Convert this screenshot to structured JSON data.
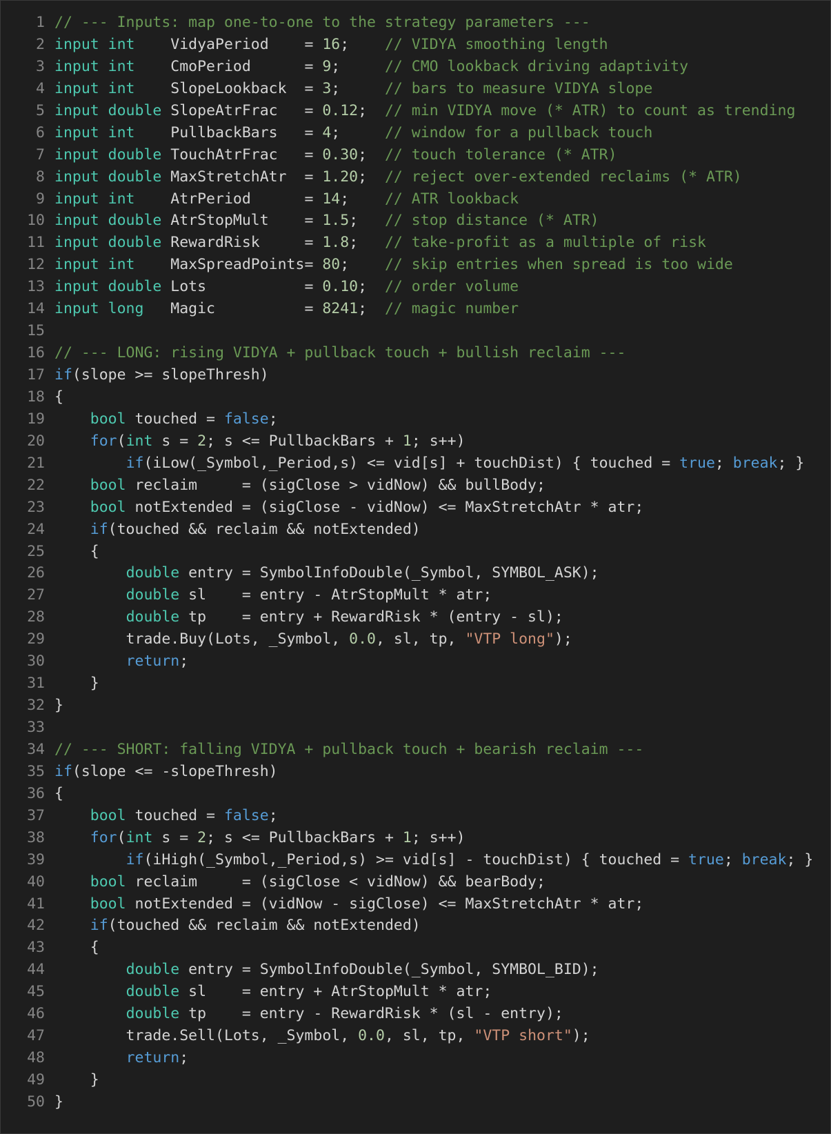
{
  "editor": {
    "colors": {
      "background": "#1e1e1e",
      "line_number": "#858585",
      "plain": "#d4d4d4",
      "keyword": "#569cd6",
      "type": "#4ec9b0",
      "number": "#b5cea8",
      "string": "#ce9178",
      "comment": "#6a9955"
    },
    "lines": [
      {
        "n": "1",
        "tokens": [
          [
            "com",
            "// --- Inputs: map one-to-one to the strategy parameters ---"
          ]
        ]
      },
      {
        "n": "2",
        "tokens": [
          [
            "type",
            "input int"
          ],
          [
            "plain",
            "    VidyaPeriod    = "
          ],
          [
            "num",
            "16"
          ],
          [
            "plain",
            ";    "
          ],
          [
            "com",
            "// VIDYA smoothing length"
          ]
        ]
      },
      {
        "n": "3",
        "tokens": [
          [
            "type",
            "input int"
          ],
          [
            "plain",
            "    CmoPeriod      = "
          ],
          [
            "num",
            "9"
          ],
          [
            "plain",
            ";     "
          ],
          [
            "com",
            "// CMO lookback driving adaptivity"
          ]
        ]
      },
      {
        "n": "4",
        "tokens": [
          [
            "type",
            "input int"
          ],
          [
            "plain",
            "    SlopeLookback  = "
          ],
          [
            "num",
            "3"
          ],
          [
            "plain",
            ";     "
          ],
          [
            "com",
            "// bars to measure VIDYA slope"
          ]
        ]
      },
      {
        "n": "5",
        "tokens": [
          [
            "type",
            "input double"
          ],
          [
            "plain",
            " SlopeAtrFrac   = "
          ],
          [
            "num",
            "0.12"
          ],
          [
            "plain",
            ";  "
          ],
          [
            "com",
            "// min VIDYA move (* ATR) to count as trending"
          ]
        ]
      },
      {
        "n": "6",
        "tokens": [
          [
            "type",
            "input int"
          ],
          [
            "plain",
            "    PullbackBars   = "
          ],
          [
            "num",
            "4"
          ],
          [
            "plain",
            ";     "
          ],
          [
            "com",
            "// window for a pullback touch"
          ]
        ]
      },
      {
        "n": "7",
        "tokens": [
          [
            "type",
            "input double"
          ],
          [
            "plain",
            " TouchAtrFrac   = "
          ],
          [
            "num",
            "0.30"
          ],
          [
            "plain",
            ";  "
          ],
          [
            "com",
            "// touch tolerance (* ATR)"
          ]
        ]
      },
      {
        "n": "8",
        "tokens": [
          [
            "type",
            "input double"
          ],
          [
            "plain",
            " MaxStretchAtr  = "
          ],
          [
            "num",
            "1.20"
          ],
          [
            "plain",
            ";  "
          ],
          [
            "com",
            "// reject over-extended reclaims (* ATR)"
          ]
        ]
      },
      {
        "n": "9",
        "tokens": [
          [
            "type",
            "input int"
          ],
          [
            "plain",
            "    AtrPeriod      = "
          ],
          [
            "num",
            "14"
          ],
          [
            "plain",
            ";    "
          ],
          [
            "com",
            "// ATR lookback"
          ]
        ]
      },
      {
        "n": "10",
        "tokens": [
          [
            "type",
            "input double"
          ],
          [
            "plain",
            " AtrStopMult    = "
          ],
          [
            "num",
            "1.5"
          ],
          [
            "plain",
            ";   "
          ],
          [
            "com",
            "// stop distance (* ATR)"
          ]
        ]
      },
      {
        "n": "11",
        "tokens": [
          [
            "type",
            "input double"
          ],
          [
            "plain",
            " RewardRisk     = "
          ],
          [
            "num",
            "1.8"
          ],
          [
            "plain",
            ";   "
          ],
          [
            "com",
            "// take-profit as a multiple of risk"
          ]
        ]
      },
      {
        "n": "12",
        "tokens": [
          [
            "type",
            "input int"
          ],
          [
            "plain",
            "    MaxSpreadPoints= "
          ],
          [
            "num",
            "80"
          ],
          [
            "plain",
            ";    "
          ],
          [
            "com",
            "// skip entries when spread is too wide"
          ]
        ]
      },
      {
        "n": "13",
        "tokens": [
          [
            "type",
            "input double"
          ],
          [
            "plain",
            " Lots           = "
          ],
          [
            "num",
            "0.10"
          ],
          [
            "plain",
            ";  "
          ],
          [
            "com",
            "// order volume"
          ]
        ]
      },
      {
        "n": "14",
        "tokens": [
          [
            "type",
            "input long"
          ],
          [
            "plain",
            "   Magic          = "
          ],
          [
            "num",
            "8241"
          ],
          [
            "plain",
            ";  "
          ],
          [
            "com",
            "// magic number"
          ]
        ]
      },
      {
        "n": "15",
        "tokens": []
      },
      {
        "n": "16",
        "tokens": [
          [
            "com",
            "// --- LONG: rising VIDYA + pullback touch + bullish reclaim ---"
          ]
        ]
      },
      {
        "n": "17",
        "tokens": [
          [
            "kw",
            "if"
          ],
          [
            "plain",
            "(slope >= slopeThresh)"
          ]
        ]
      },
      {
        "n": "18",
        "tokens": [
          [
            "plain",
            "{"
          ]
        ]
      },
      {
        "n": "19",
        "tokens": [
          [
            "plain",
            "    "
          ],
          [
            "type",
            "bool"
          ],
          [
            "plain",
            " touched = "
          ],
          [
            "kw",
            "false"
          ],
          [
            "plain",
            ";"
          ]
        ]
      },
      {
        "n": "20",
        "tokens": [
          [
            "plain",
            "    "
          ],
          [
            "kw",
            "for"
          ],
          [
            "plain",
            "("
          ],
          [
            "type",
            "int"
          ],
          [
            "plain",
            " s = "
          ],
          [
            "num",
            "2"
          ],
          [
            "plain",
            "; s <= PullbackBars + "
          ],
          [
            "num",
            "1"
          ],
          [
            "plain",
            "; s++)"
          ]
        ]
      },
      {
        "n": "21",
        "tokens": [
          [
            "plain",
            "        "
          ],
          [
            "kw",
            "if"
          ],
          [
            "plain",
            "(iLow(_Symbol,_Period,s) <= vid[s] + touchDist) { touched = "
          ],
          [
            "kw",
            "true"
          ],
          [
            "plain",
            "; "
          ],
          [
            "kw",
            "break"
          ],
          [
            "plain",
            "; }"
          ]
        ]
      },
      {
        "n": "22",
        "tokens": [
          [
            "plain",
            "    "
          ],
          [
            "type",
            "bool"
          ],
          [
            "plain",
            " reclaim     = (sigClose > vidNow) && bullBody;"
          ]
        ]
      },
      {
        "n": "23",
        "tokens": [
          [
            "plain",
            "    "
          ],
          [
            "type",
            "bool"
          ],
          [
            "plain",
            " notExtended = (sigClose - vidNow) <= MaxStretchAtr * atr;"
          ]
        ]
      },
      {
        "n": "24",
        "tokens": [
          [
            "plain",
            "    "
          ],
          [
            "kw",
            "if"
          ],
          [
            "plain",
            "(touched && reclaim && notExtended)"
          ]
        ]
      },
      {
        "n": "25",
        "tokens": [
          [
            "plain",
            "    {"
          ]
        ]
      },
      {
        "n": "26",
        "tokens": [
          [
            "plain",
            "        "
          ],
          [
            "type",
            "double"
          ],
          [
            "plain",
            " entry = SymbolInfoDouble(_Symbol, SYMBOL_ASK);"
          ]
        ]
      },
      {
        "n": "27",
        "tokens": [
          [
            "plain",
            "        "
          ],
          [
            "type",
            "double"
          ],
          [
            "plain",
            " sl    = entry - AtrStopMult * atr;"
          ]
        ]
      },
      {
        "n": "28",
        "tokens": [
          [
            "plain",
            "        "
          ],
          [
            "type",
            "double"
          ],
          [
            "plain",
            " tp    = entry + RewardRisk * (entry - sl);"
          ]
        ]
      },
      {
        "n": "29",
        "tokens": [
          [
            "plain",
            "        trade.Buy(Lots, _Symbol, "
          ],
          [
            "num",
            "0.0"
          ],
          [
            "plain",
            ", sl, tp, "
          ],
          [
            "str",
            "\"VTP long\""
          ],
          [
            "plain",
            ");"
          ]
        ]
      },
      {
        "n": "30",
        "tokens": [
          [
            "plain",
            "        "
          ],
          [
            "kw",
            "return"
          ],
          [
            "plain",
            ";"
          ]
        ]
      },
      {
        "n": "31",
        "tokens": [
          [
            "plain",
            "    }"
          ]
        ]
      },
      {
        "n": "32",
        "tokens": [
          [
            "plain",
            "}"
          ]
        ]
      },
      {
        "n": "33",
        "tokens": []
      },
      {
        "n": "34",
        "tokens": [
          [
            "com",
            "// --- SHORT: falling VIDYA + pullback touch + bearish reclaim ---"
          ]
        ]
      },
      {
        "n": "35",
        "tokens": [
          [
            "kw",
            "if"
          ],
          [
            "plain",
            "(slope <= -slopeThresh)"
          ]
        ]
      },
      {
        "n": "36",
        "tokens": [
          [
            "plain",
            "{"
          ]
        ]
      },
      {
        "n": "37",
        "tokens": [
          [
            "plain",
            "    "
          ],
          [
            "type",
            "bool"
          ],
          [
            "plain",
            " touched = "
          ],
          [
            "kw",
            "false"
          ],
          [
            "plain",
            ";"
          ]
        ]
      },
      {
        "n": "38",
        "tokens": [
          [
            "plain",
            "    "
          ],
          [
            "kw",
            "for"
          ],
          [
            "plain",
            "("
          ],
          [
            "type",
            "int"
          ],
          [
            "plain",
            " s = "
          ],
          [
            "num",
            "2"
          ],
          [
            "plain",
            "; s <= PullbackBars + "
          ],
          [
            "num",
            "1"
          ],
          [
            "plain",
            "; s++)"
          ]
        ]
      },
      {
        "n": "39",
        "tokens": [
          [
            "plain",
            "        "
          ],
          [
            "kw",
            "if"
          ],
          [
            "plain",
            "(iHigh(_Symbol,_Period,s) >= vid[s] - touchDist) { touched = "
          ],
          [
            "kw",
            "true"
          ],
          [
            "plain",
            "; "
          ],
          [
            "kw",
            "break"
          ],
          [
            "plain",
            "; }"
          ]
        ]
      },
      {
        "n": "40",
        "tokens": [
          [
            "plain",
            "    "
          ],
          [
            "type",
            "bool"
          ],
          [
            "plain",
            " reclaim     = (sigClose < vidNow) && bearBody;"
          ]
        ]
      },
      {
        "n": "41",
        "tokens": [
          [
            "plain",
            "    "
          ],
          [
            "type",
            "bool"
          ],
          [
            "plain",
            " notExtended = (vidNow - sigClose) <= MaxStretchAtr * atr;"
          ]
        ]
      },
      {
        "n": "42",
        "tokens": [
          [
            "plain",
            "    "
          ],
          [
            "kw",
            "if"
          ],
          [
            "plain",
            "(touched && reclaim && notExtended)"
          ]
        ]
      },
      {
        "n": "43",
        "tokens": [
          [
            "plain",
            "    {"
          ]
        ]
      },
      {
        "n": "44",
        "tokens": [
          [
            "plain",
            "        "
          ],
          [
            "type",
            "double"
          ],
          [
            "plain",
            " entry = SymbolInfoDouble(_Symbol, SYMBOL_BID);"
          ]
        ]
      },
      {
        "n": "45",
        "tokens": [
          [
            "plain",
            "        "
          ],
          [
            "type",
            "double"
          ],
          [
            "plain",
            " sl    = entry + AtrStopMult * atr;"
          ]
        ]
      },
      {
        "n": "46",
        "tokens": [
          [
            "plain",
            "        "
          ],
          [
            "type",
            "double"
          ],
          [
            "plain",
            " tp    = entry - RewardRisk * (sl - entry);"
          ]
        ]
      },
      {
        "n": "47",
        "tokens": [
          [
            "plain",
            "        trade.Sell(Lots, _Symbol, "
          ],
          [
            "num",
            "0.0"
          ],
          [
            "plain",
            ", sl, tp, "
          ],
          [
            "str",
            "\"VTP short\""
          ],
          [
            "plain",
            ");"
          ]
        ]
      },
      {
        "n": "48",
        "tokens": [
          [
            "plain",
            "        "
          ],
          [
            "kw",
            "return"
          ],
          [
            "plain",
            ";"
          ]
        ]
      },
      {
        "n": "49",
        "tokens": [
          [
            "plain",
            "    }"
          ]
        ]
      },
      {
        "n": "50",
        "tokens": [
          [
            "plain",
            "}"
          ]
        ]
      }
    ]
  }
}
